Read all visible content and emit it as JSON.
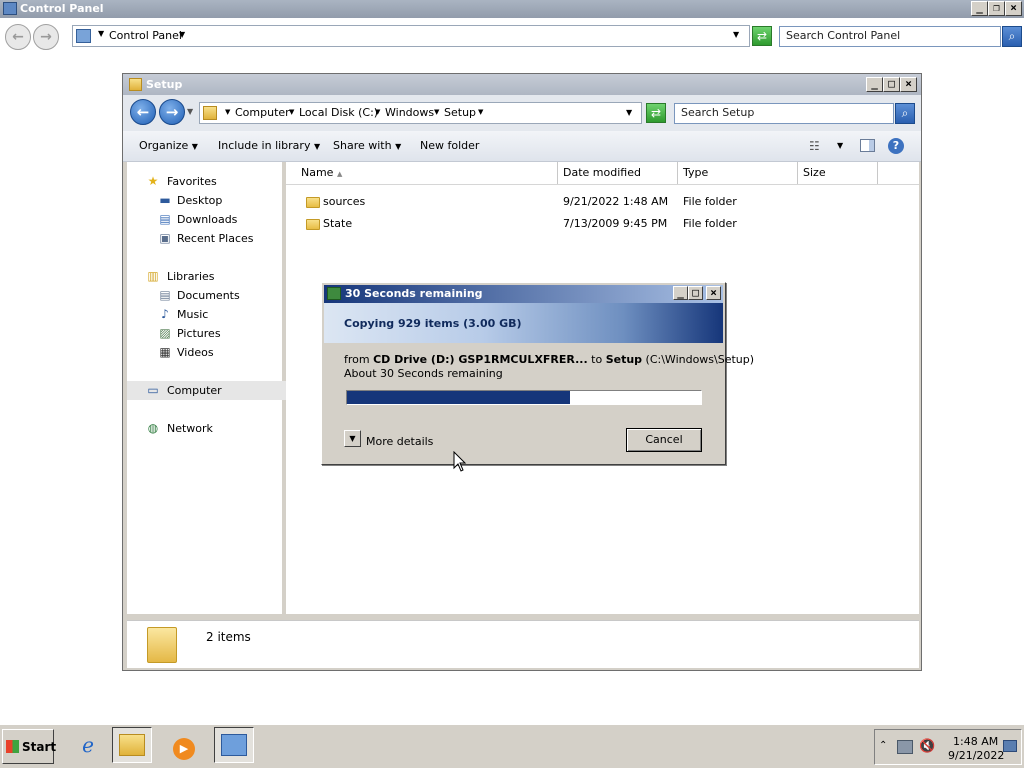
{
  "outer_window": {
    "title": "Control Panel",
    "address_label": "Control Panel",
    "search_placeholder": "Search Control Panel"
  },
  "setup_window": {
    "title": "Setup",
    "breadcrumbs": [
      "Computer",
      "Local Disk (C:)",
      "Windows",
      "Setup"
    ],
    "search_placeholder": "Search Setup",
    "toolbar": {
      "organize": "Organize",
      "include_in_library": "Include in library",
      "share_with": "Share with",
      "new_folder": "New folder"
    },
    "nav": {
      "favorites": "Favorites",
      "desktop": "Desktop",
      "downloads": "Downloads",
      "recent_places": "Recent Places",
      "libraries": "Libraries",
      "documents": "Documents",
      "music": "Music",
      "pictures": "Pictures",
      "videos": "Videos",
      "computer": "Computer",
      "network": "Network"
    },
    "columns": {
      "name": "Name",
      "date_modified": "Date modified",
      "type": "Type",
      "size": "Size"
    },
    "files": [
      {
        "name": "sources",
        "date": "9/21/2022 1:48 AM",
        "type": "File folder"
      },
      {
        "name": "State",
        "date": "7/13/2009 9:45 PM",
        "type": "File folder"
      }
    ],
    "status": "2 items"
  },
  "copy_dialog": {
    "title": "30 Seconds remaining",
    "heading": "Copying 929 items (3.00 GB)",
    "from_prefix": "from",
    "from_source": "CD Drive (D:) GSP1RMCULXFRER...",
    "to_prefix": "to",
    "to_dest": "Setup",
    "to_path": "(C:\\Windows\\Setup)",
    "remaining": "About 30 Seconds remaining",
    "progress_fraction": 0.63,
    "more_details": "More details",
    "cancel": "Cancel"
  },
  "taskbar": {
    "start": "Start",
    "time": "1:48 AM",
    "date": "9/21/2022"
  },
  "colors": {
    "accent_blue": "#16367a",
    "dialog_gray": "#d4d0c8"
  }
}
